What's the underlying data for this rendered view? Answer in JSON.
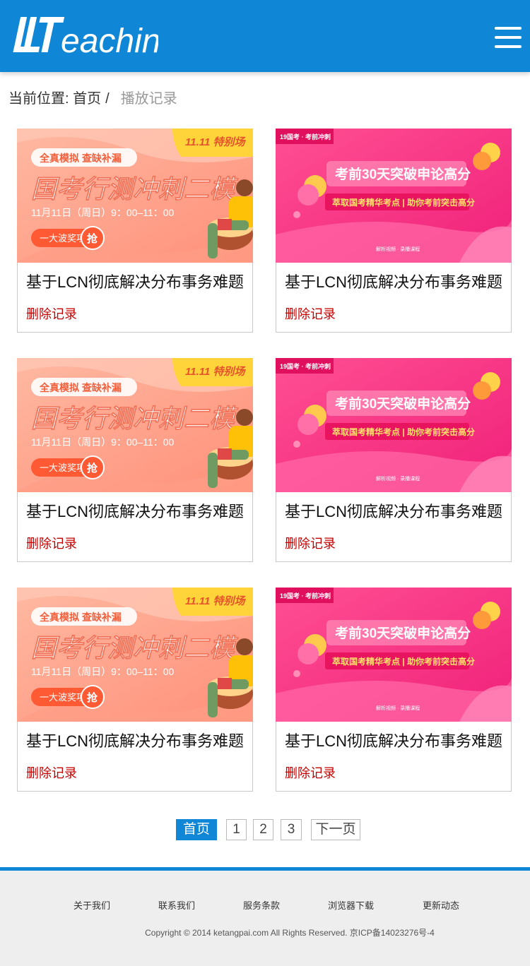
{
  "header": {
    "logo_mark": "LT",
    "logo_text": "eaching",
    "logo_full": "LTeaching"
  },
  "breadcrumb": {
    "prefix": "当前位置:",
    "home": "首页",
    "separator": "/",
    "current": "播放记录"
  },
  "banners": {
    "a": {
      "tag": "11.11 特别场",
      "subtitle": "全真模拟 查缺补漏",
      "headline": "国考行测冲刺二模",
      "date": "11月11日（周日）9：00–11：00",
      "cta": "一大波奖项",
      "cta_badge": "抢"
    },
    "b": {
      "tag": "19国考 · 考前冲刺",
      "headline": "考前30天突破申论高分",
      "subtitle": "萃取国考精华考点 | 助你考前突击高分",
      "footer": "解析视频 · 录播课程"
    }
  },
  "cards": [
    {
      "title": "基于LCN彻底解决分布事务难题",
      "delete_label": "删除记录",
      "banner": "a"
    },
    {
      "title": "基于LCN彻底解决分布事务难题",
      "delete_label": "删除记录",
      "banner": "b"
    },
    {
      "title": "基于LCN彻底解决分布事务难题",
      "delete_label": "删除记录",
      "banner": "a"
    },
    {
      "title": "基于LCN彻底解决分布事务难题",
      "delete_label": "删除记录",
      "banner": "b"
    },
    {
      "title": "基于LCN彻底解决分布事务难题",
      "delete_label": "删除记录",
      "banner": "a"
    },
    {
      "title": "基于LCN彻底解决分布事务难题",
      "delete_label": "删除记录",
      "banner": "b"
    }
  ],
  "pagination": {
    "first": "首页",
    "pages": [
      "1",
      "2",
      "3"
    ],
    "next": "下一页",
    "active": "first"
  },
  "footer": {
    "links": [
      "关于我们",
      "联系我们",
      "服务条款",
      "浏览器下载",
      "更新动态"
    ],
    "copyright": "Copyright © 2014 ketangpai.com All Rights Reserved. 京ICP备14023276号-4"
  },
  "colors": {
    "brand_blue": "#0f86d6",
    "delete_red": "#c40000",
    "footer_bg": "#eeeeee"
  }
}
